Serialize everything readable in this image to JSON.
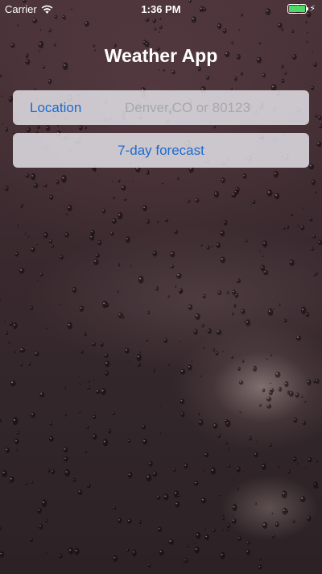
{
  "status_bar": {
    "carrier": "Carrier",
    "time": "1:36 PM",
    "battery_color": "#4cd964",
    "wifi_icon": "wifi-icon",
    "battery_icon": "battery-icon",
    "charging_icon": "charging-icon",
    "charging_glyph": "⚡"
  },
  "title": "Weather App",
  "location": {
    "label": "Location",
    "value": "",
    "placeholder": "Denver,CO or 80123"
  },
  "forecast_button": {
    "label": "7-day forecast"
  },
  "colors": {
    "accent": "#1c6bd1",
    "background": "#3b2a2f"
  }
}
